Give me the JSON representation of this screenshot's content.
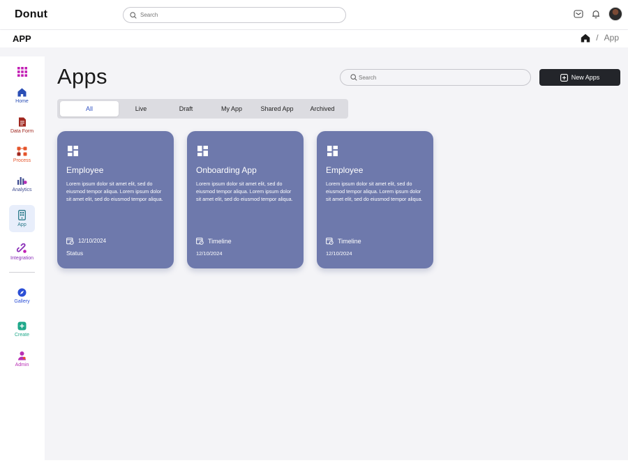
{
  "app": {
    "brand": "Donut"
  },
  "topbar": {
    "search_placeholder": "Search"
  },
  "subheader": {
    "title": "APP",
    "breadcrumb_sep": "/",
    "breadcrumb_current": "App"
  },
  "sidebar": {
    "items": [
      {
        "label": "",
        "icon": "grid-icon",
        "color": "#c21fb4"
      },
      {
        "label": "Home",
        "icon": "home-icon",
        "color": "#2b4fb5"
      },
      {
        "label": "Data Form",
        "icon": "document-icon",
        "color": "#a0271f"
      },
      {
        "label": "Process",
        "icon": "process-icon",
        "color": "#e5542a"
      },
      {
        "label": "Analytics",
        "icon": "analytics-icon",
        "color": "#3d4a8f"
      },
      {
        "label": "App",
        "icon": "phone-app-icon",
        "color": "#2b7a8a"
      },
      {
        "label": "Integration",
        "icon": "link-icon",
        "color": "#8a2fb8"
      },
      {
        "label": "Gallery",
        "icon": "compass-icon",
        "color": "#2b4fd6"
      },
      {
        "label": "Create",
        "icon": "plus-icon",
        "color": "#1fa88a"
      },
      {
        "label": "Admin",
        "icon": "admin-icon",
        "color": "#b82fb4"
      }
    ]
  },
  "main": {
    "title": "Apps",
    "search_placeholder": "Search",
    "new_button": "New Apps",
    "tabs": [
      "All",
      "Live",
      "Draft",
      "My App",
      "Shared App",
      "Archived"
    ],
    "active_tab": "All",
    "cards": [
      {
        "title": "Employee",
        "description": "Lorem ipsum dolor sit amet elit, sed do eiusmod tempor aliqua. Lorem ipsum dolor sit amet elit, sed do eiusmod tempor aliqua.",
        "meta1": "12/10/2024",
        "meta2": "Status"
      },
      {
        "title": "Onboarding App",
        "description": "Lorem ipsum dolor sit amet elit, sed do eiusmod tempor aliqua. Lorem ipsum dolor sit amet elit, sed do eiusmod tempor aliqua.",
        "meta1": "Timeline",
        "meta2": "12/10/2024"
      },
      {
        "title": "Employee",
        "description": "Lorem ipsum dolor sit amet elit, sed do eiusmod tempor aliqua. Lorem ipsum dolor sit amet elit, sed do eiusmod tempor aliqua.",
        "meta1": "Timeline",
        "meta2": "12/10/2024"
      }
    ]
  },
  "colors": {
    "card_bg": "#6e79ac",
    "active_tab_text": "#3354c4",
    "button_bg": "#23252a"
  }
}
